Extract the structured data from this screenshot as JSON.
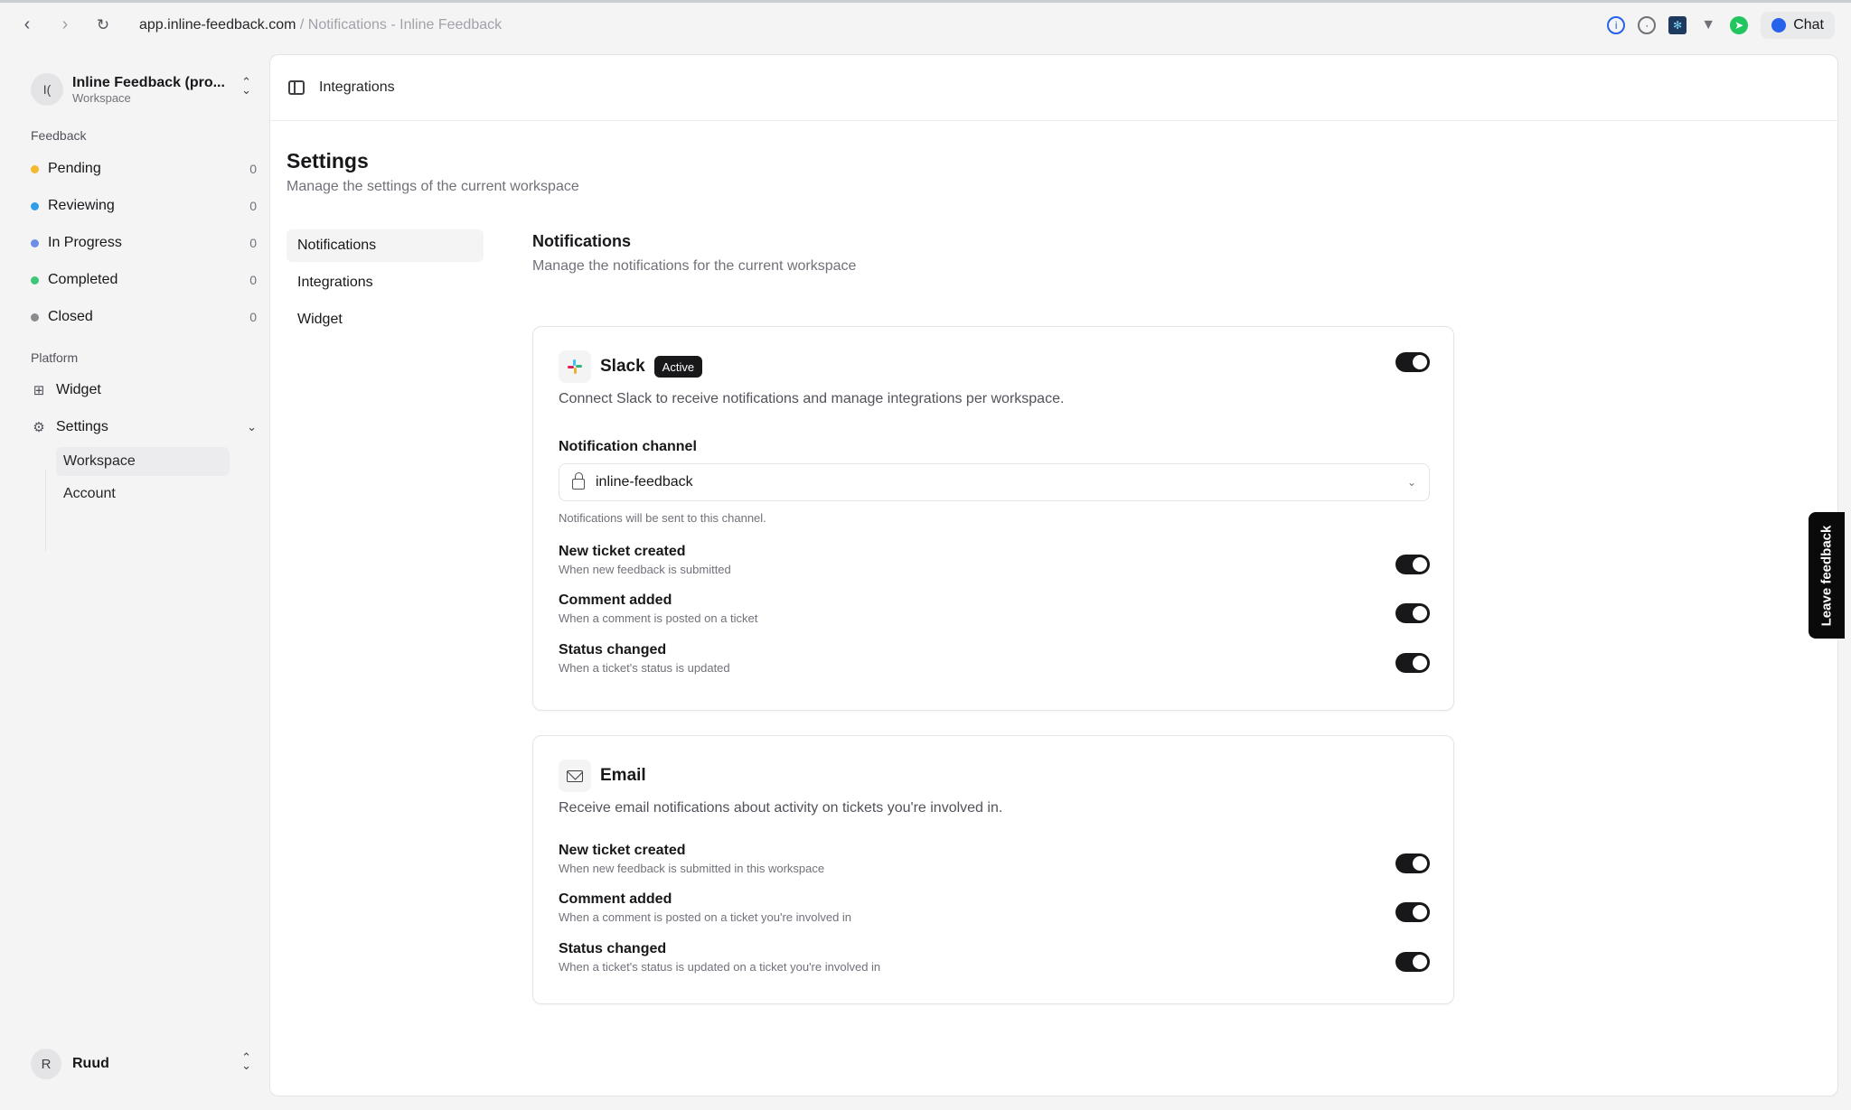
{
  "browser": {
    "url_host": "app.inline-feedback.com",
    "url_sep": " / ",
    "url_page": "Notifications - Inline Feedback",
    "chat_label": "Chat"
  },
  "sidebar": {
    "workspace": {
      "initials": "I(",
      "name": "Inline Feedback (pro...",
      "type": "Workspace"
    },
    "feedback_label": "Feedback",
    "feedback_items": [
      {
        "label": "Pending",
        "count": "0",
        "color": "#f5b82e"
      },
      {
        "label": "Reviewing",
        "count": "0",
        "color": "#2f9ee8"
      },
      {
        "label": "In Progress",
        "count": "0",
        "color": "#6b8fe6"
      },
      {
        "label": "Completed",
        "count": "0",
        "color": "#3cc77a"
      },
      {
        "label": "Closed",
        "count": "0",
        "color": "#8a8a8f"
      }
    ],
    "platform_label": "Platform",
    "widget_label": "Widget",
    "settings_label": "Settings",
    "settings_sub": [
      {
        "label": "Workspace"
      },
      {
        "label": "Account"
      }
    ],
    "user": {
      "initial": "R",
      "name": "Ruud"
    }
  },
  "main": {
    "breadcrumb": "Integrations",
    "title": "Settings",
    "subtitle": "Manage the settings of the current workspace",
    "subnav": [
      {
        "label": "Notifications"
      },
      {
        "label": "Integrations"
      },
      {
        "label": "Widget"
      }
    ],
    "section_title": "Notifications",
    "section_subtitle": "Manage the notifications for the current workspace",
    "slack": {
      "name": "Slack",
      "badge": "Active",
      "enabled": true,
      "description": "Connect Slack to receive notifications and manage integrations per workspace.",
      "channel_label": "Notification channel",
      "channel_value": "inline-feedback",
      "channel_helper": "Notifications will be sent to this channel.",
      "rows": [
        {
          "title": "New ticket created",
          "sub": "When new feedback is submitted",
          "enabled": true
        },
        {
          "title": "Comment added",
          "sub": "When a comment is posted on a ticket",
          "enabled": true
        },
        {
          "title": "Status changed",
          "sub": "When a ticket's status is updated",
          "enabled": true
        }
      ]
    },
    "email": {
      "name": "Email",
      "description": "Receive email notifications about activity on tickets you're involved in.",
      "rows": [
        {
          "title": "New ticket created",
          "sub": "When new feedback is submitted in this workspace",
          "enabled": true
        },
        {
          "title": "Comment added",
          "sub": "When a comment is posted on a ticket you're involved in",
          "enabled": true
        },
        {
          "title": "Status changed",
          "sub": "When a ticket's status is updated on a ticket you're involved in",
          "enabled": true
        }
      ]
    }
  },
  "feedback_tab_label": "Leave feedback"
}
